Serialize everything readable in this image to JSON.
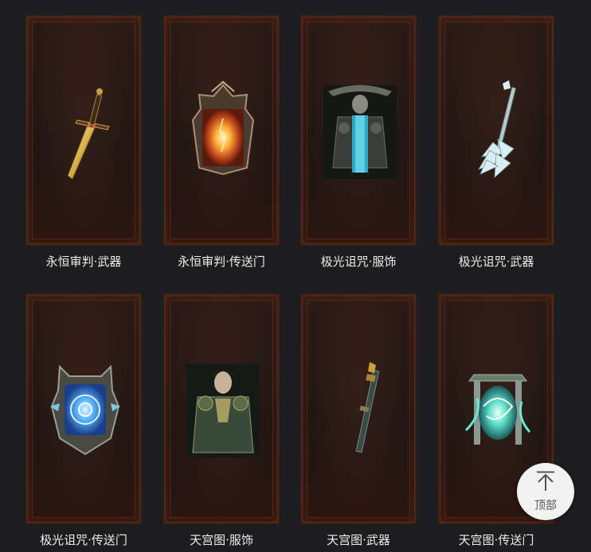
{
  "items": [
    {
      "label": "永恒审判·武器",
      "icon": "golden-sword-icon"
    },
    {
      "label": "永恒审判·传送门",
      "icon": "fiery-portal-icon"
    },
    {
      "label": "极光诅咒·服饰",
      "icon": "dark-armor-costume-icon"
    },
    {
      "label": "极光诅咒·武器",
      "icon": "ice-spiked-mace-icon"
    },
    {
      "label": "极光诅咒·传送门",
      "icon": "blue-rune-portal-icon"
    },
    {
      "label": "天宫图·服饰",
      "icon": "jade-armor-costume-icon"
    },
    {
      "label": "天宫图·武器",
      "icon": "jade-staff-icon"
    },
    {
      "label": "天宫图·传送门",
      "icon": "spirit-gate-portal-icon"
    }
  ],
  "back_to_top": {
    "label": "顶部",
    "icon": "arrow-up-to-top-icon"
  },
  "colors": {
    "page_bg": "#1d1d1f",
    "frame_border": "#5a2b1a",
    "label_text": "#ececec",
    "button_bg": "#f2f2f2"
  }
}
